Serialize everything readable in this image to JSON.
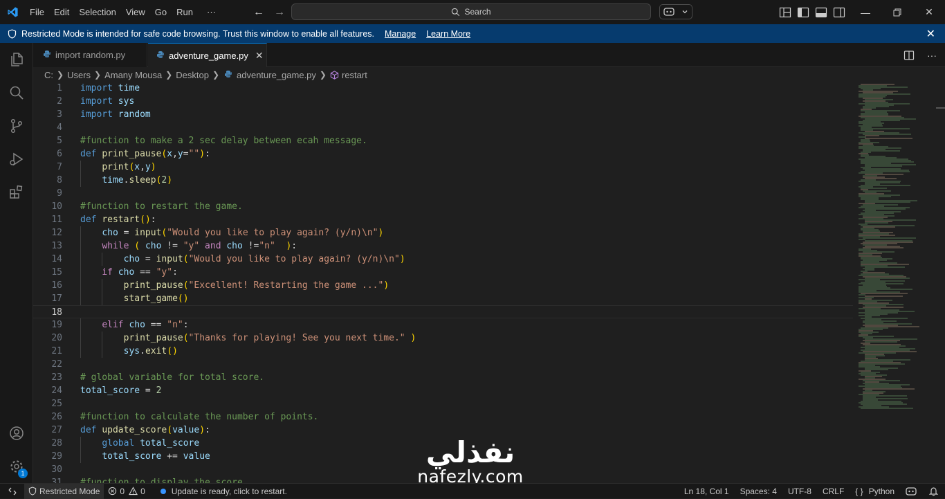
{
  "menu": [
    "File",
    "Edit",
    "Selection",
    "View",
    "Go",
    "Run",
    "···"
  ],
  "search": {
    "label": "Search"
  },
  "banner": {
    "message": "Restricted Mode is intended for safe code browsing. Trust this window to enable all features.",
    "manage": "Manage",
    "learn_more": "Learn More"
  },
  "tabs": [
    {
      "label": "import random.py",
      "active": false
    },
    {
      "label": "adventure_game.py",
      "active": true
    }
  ],
  "breadcrumb": [
    "C:",
    "Users",
    "Amany Mousa",
    "Desktop",
    "adventure_game.py",
    "restart"
  ],
  "editor": {
    "current_line": 18,
    "lines": [
      {
        "n": "1",
        "t": "import time"
      },
      {
        "n": "2",
        "t": "import sys"
      },
      {
        "n": "3",
        "t": "import random"
      },
      {
        "n": "4",
        "t": ""
      },
      {
        "n": "5",
        "t": "#function to make a 2 sec delay between ecah message."
      },
      {
        "n": "6",
        "t": "def print_pause(x,y=\"\"):"
      },
      {
        "n": "7",
        "t": "    print(x,y)"
      },
      {
        "n": "8",
        "t": "    time.sleep(2)"
      },
      {
        "n": "9",
        "t": ""
      },
      {
        "n": "10",
        "t": "#function to restart the game."
      },
      {
        "n": "11",
        "t": "def restart():"
      },
      {
        "n": "12",
        "t": "    cho = input(\"Would you like to play again? (y/n)\\n\")"
      },
      {
        "n": "13",
        "t": "    while ( cho != \"y\" and cho !=\"n\"  ):"
      },
      {
        "n": "14",
        "t": "        cho = input(\"Would you like to play again? (y/n)\\n\")"
      },
      {
        "n": "15",
        "t": "    if cho == \"y\":"
      },
      {
        "n": "16",
        "t": "        print_pause(\"Excellent! Restarting the game ...\")"
      },
      {
        "n": "17",
        "t": "        start_game()"
      },
      {
        "n": "18",
        "t": ""
      },
      {
        "n": "19",
        "t": "    elif cho == \"n\":"
      },
      {
        "n": "20",
        "t": "        print_pause(\"Thanks for playing! See you next time.\" )"
      },
      {
        "n": "21",
        "t": "        sys.exit()"
      },
      {
        "n": "22",
        "t": ""
      },
      {
        "n": "23",
        "t": "# global variable for total score."
      },
      {
        "n": "24",
        "t": "total_score = 2"
      },
      {
        "n": "25",
        "t": ""
      },
      {
        "n": "26",
        "t": "#function to calculate the number of points."
      },
      {
        "n": "27",
        "t": "def update_score(value):"
      },
      {
        "n": "28",
        "t": "    global total_score"
      },
      {
        "n": "29",
        "t": "    total_score += value"
      },
      {
        "n": "30",
        "t": ""
      },
      {
        "n": "31",
        "t": "#function to display the score"
      }
    ]
  },
  "status": {
    "restricted": "Restricted Mode",
    "errors": "0",
    "warnings": "0",
    "update": "Update is ready, click to restart.",
    "position": "Ln 18, Col 1",
    "spaces": "Spaces: 4",
    "encoding": "UTF-8",
    "eol": "CRLF",
    "language_braces": "{ }",
    "language": "Python",
    "accounts_badge": "1"
  },
  "watermark": {
    "arabic": "نفذلي",
    "latin": "nafezly.com"
  },
  "colors": {
    "accent": "#0078d4",
    "banner": "#063b6e",
    "editor_bg": "#1f1f1f"
  }
}
